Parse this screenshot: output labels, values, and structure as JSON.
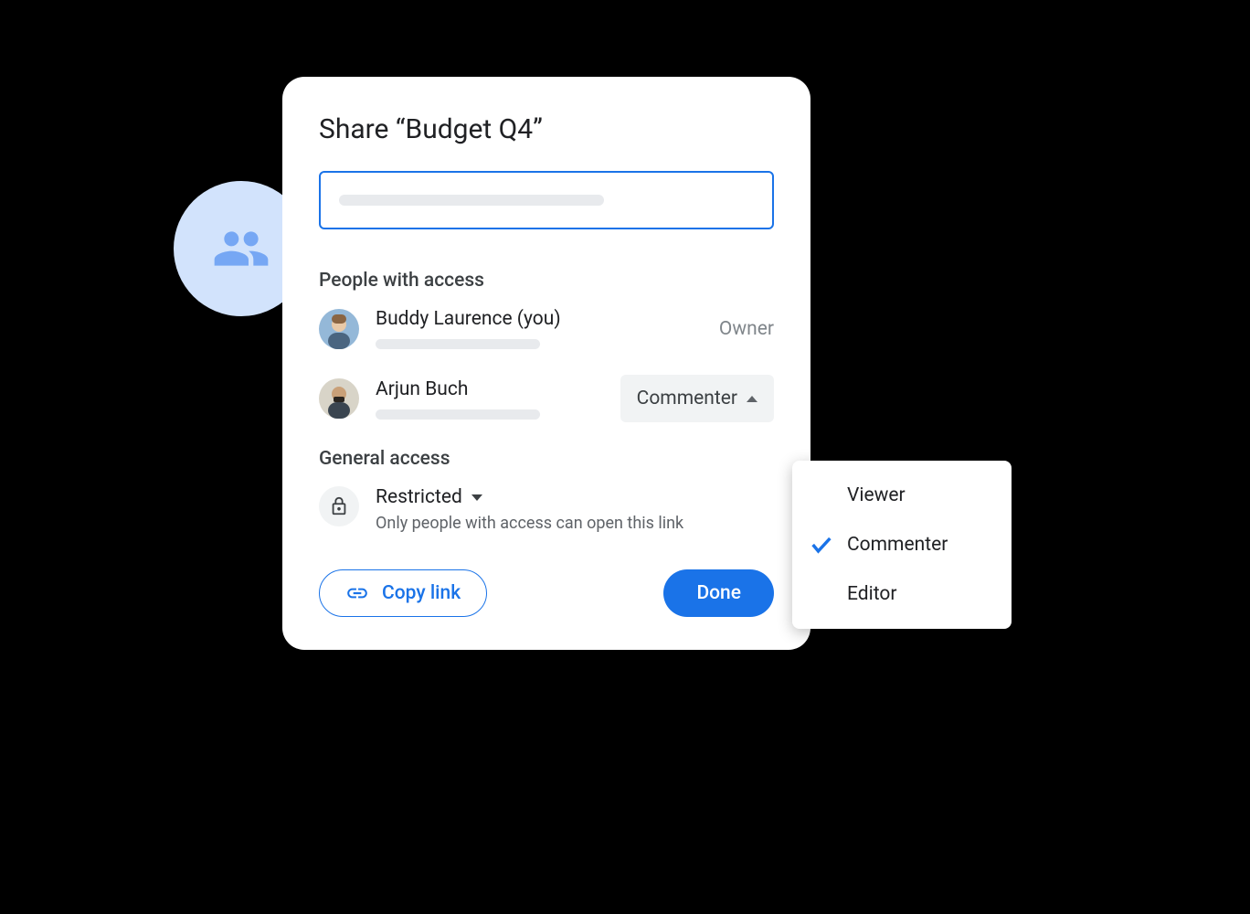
{
  "dialog": {
    "title": "Share “Budget Q4”",
    "people_section_label": "People with access",
    "general_section_label": "General access",
    "restricted_label": "Restricted",
    "restricted_desc": "Only people with access can open this link",
    "copy_link_label": "Copy link",
    "done_label": "Done"
  },
  "people": [
    {
      "name": "Buddy Laurence (you)",
      "role": "Owner"
    },
    {
      "name": "Arjun Buch",
      "role": "Commenter"
    }
  ],
  "dropdown": {
    "options": [
      "Viewer",
      "Commenter",
      "Editor"
    ],
    "selected": "Commenter"
  }
}
